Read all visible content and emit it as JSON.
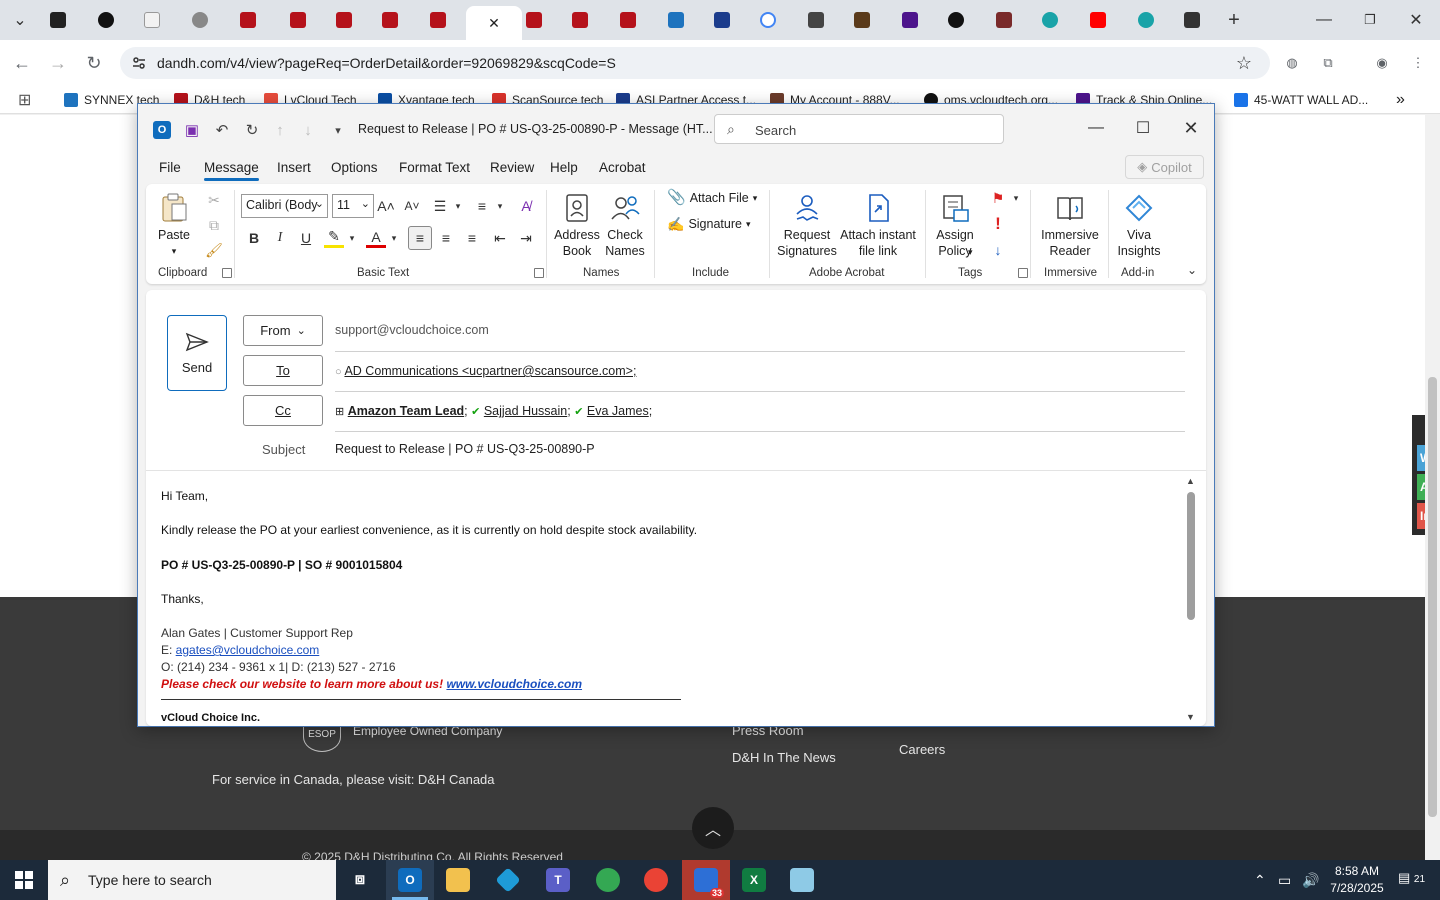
{
  "browser": {
    "tabs_visible": 24,
    "active_tab_close": "✕",
    "new_tab": "+",
    "url": "dandh.com/v4/view?pageReq=OrderDetail&order=92069829&scqCode=S",
    "bookmarks": [
      {
        "label": "SYNNEX tech",
        "color": "#1e73be"
      },
      {
        "label": "D&H tech",
        "color": "#b5121b"
      },
      {
        "label": "LvCloud Tech",
        "color": "#e74c3c"
      },
      {
        "label": "Xvantage tech",
        "color": "#0a4ea3"
      },
      {
        "label": "ScanSource tech",
        "color": "#d9322b"
      },
      {
        "label": "ASI Partner Access t...",
        "color": "#1b3c8c"
      },
      {
        "label": "My Account - 888V...",
        "color": "#6b3b2a"
      },
      {
        "label": "oms.vcloudtech.org...",
        "color": "#111111"
      },
      {
        "label": "Track & Ship Online...",
        "color": "#4d148c"
      },
      {
        "label": "45-WATT WALL AD...",
        "color": "#1a73e8"
      }
    ],
    "more_bookmarks": "»"
  },
  "webpage": {
    "footer_items": {
      "esop": "Employee Owned Company",
      "canada": "For service in Canada, please visit: D&H Canada",
      "press": "Press Room",
      "news": "D&H In The News",
      "careers": "Careers",
      "copyright": "© 2025 D&H Distributing Co. All Rights Reserved",
      "esop_logo": "ESOP"
    },
    "side_tabs": [
      {
        "label": "W",
        "color": "#4aa3d6"
      },
      {
        "label": "Ac",
        "color": "#3faf55"
      },
      {
        "label": "In",
        "color": "#e0564a"
      }
    ]
  },
  "outlook": {
    "title": "Request to Release | PO # US-Q3-25-00890-P  -  Message (HT...",
    "search_placeholder": "Search",
    "menu": [
      "File",
      "Message",
      "Insert",
      "Options",
      "Format Text",
      "Review",
      "Help",
      "Acrobat"
    ],
    "active_menu": "Message",
    "copilot": "Copilot",
    "ribbon": {
      "paste": "Paste",
      "clipboard": "Clipboard",
      "font_name": "Calibri (Body",
      "font_size": "11",
      "basic_text": "Basic Text",
      "address_book": "Address Book",
      "check_names": "Check Names",
      "names": "Names",
      "attach_file": "Attach File",
      "signature": "Signature",
      "include": "Include",
      "request_signatures": "Request Signatures",
      "attach_instant": "Attach instant file link",
      "adobe_acrobat": "Adobe Acrobat",
      "assign_policy": "Assign Policy",
      "tags": "Tags",
      "immersive_reader": "Immersive Reader",
      "immersive": "Immersive",
      "viva_insights": "Viva Insights",
      "addin": "Add-in"
    },
    "compose": {
      "send": "Send",
      "from_label": "From",
      "from_value": "support@vcloudchoice.com",
      "to_label": "To",
      "to_value": "AD Communications <ucpartner@scansource.com>;",
      "cc_label": "Cc",
      "cc_group": "Amazon Team Lead",
      "cc_people": [
        "Sajjad Hussain",
        "Eva James"
      ],
      "subject_label": "Subject",
      "subject_value": "Request to Release | PO # US-Q3-25-00890-P"
    },
    "body": {
      "greeting": "Hi Team,",
      "line1": "Kindly release the PO at your earliest convenience, as it is currently on hold despite stock availability.",
      "po_line": "PO # US-Q3-25-00890-P | SO # 9001015804",
      "thanks": "Thanks,",
      "sig_name": "Alan Gates | Customer Support Rep",
      "sig_email_label": "E: ",
      "sig_email": "agates@vcloudchoice.com",
      "sig_phone": "O: (214) 234 - 9361 x 1| D: (213) 527 - 2716",
      "sig_promo": "Please check our website to learn more about us!",
      "sig_site": "www.vcloudchoice.com",
      "company": "vCloud Choice Inc."
    }
  },
  "taskbar": {
    "search_placeholder": "Type here to search",
    "time": "8:58 AM",
    "date": "7/28/2025",
    "notifications": "21",
    "zoom_badge": "33"
  },
  "colors": {
    "accent": "#0f6cbd",
    "taskbar": "#1c2a3a",
    "link": "#1a4fbf",
    "promo": "#d01010"
  }
}
